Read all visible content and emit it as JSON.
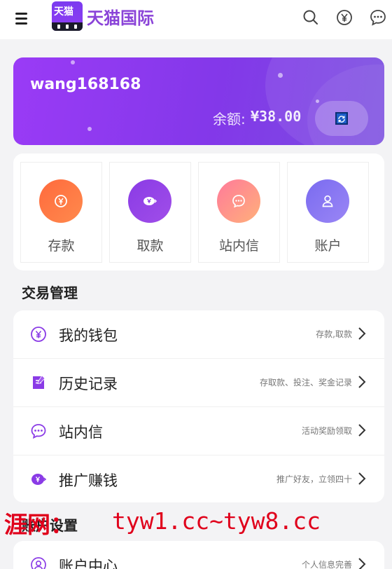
{
  "header": {
    "logo_badge": "天猫",
    "brand_name": "天猫国际",
    "icons": [
      "menu-icon",
      "search-icon",
      "yen-icon",
      "chat-icon"
    ]
  },
  "balance": {
    "username": "wang168168",
    "label": "余额:",
    "amount": "¥38.00"
  },
  "quick_actions": [
    {
      "label": "存款",
      "icon": "deposit-icon",
      "color_from": "#ff6a3d",
      "color_to": "#ff8a4d"
    },
    {
      "label": "取款",
      "icon": "withdraw-icon",
      "color_from": "#8a3be6",
      "color_to": "#a04ee8"
    },
    {
      "label": "站内信",
      "icon": "message-icon",
      "color_from": "#ff7a9a",
      "color_to": "#ffb07a"
    },
    {
      "label": "账户",
      "icon": "user-icon",
      "color_from": "#7a6bf0",
      "color_to": "#9a86f5"
    }
  ],
  "sections": {
    "trade_title": "交易管理",
    "account_title": "账户设置"
  },
  "trade_menu": [
    {
      "label": "我的钱包",
      "hint": "存款,取款",
      "icon": "wallet-icon"
    },
    {
      "label": "历史记录",
      "hint": "存取款、投注、奖金记录",
      "icon": "history-icon"
    },
    {
      "label": "站内信",
      "hint": "活动奖励领取",
      "icon": "message-icon"
    },
    {
      "label": "推广赚钱",
      "hint": "推广好友，立领四十",
      "icon": "promote-icon"
    }
  ],
  "account_menu": [
    {
      "label": "账户中心",
      "hint": "个人信息完善",
      "icon": "user-center-icon"
    }
  ],
  "watermark": {
    "cn": "涯网：",
    "url": "tyw1.cc~tyw8.cc"
  },
  "colors": {
    "brand_purple": "#8a43d8",
    "card_gradient_start": "#9a3bf6",
    "card_gradient_end": "#7a4ee0",
    "watermark_red": "#e0001b"
  }
}
